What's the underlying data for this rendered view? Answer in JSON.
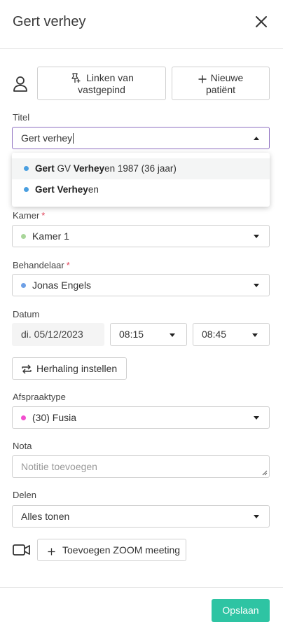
{
  "header": {
    "title": "Gert verhey",
    "close_icon": "close-icon"
  },
  "patient_actions": {
    "person_icon": "person-icon",
    "link_pinned": {
      "icon": "pin-icon",
      "line1": "Linken van",
      "line2": "vastgepind"
    },
    "new_patient": {
      "icon": "plus-icon",
      "line1": "Nieuwe",
      "line2": "patiënt"
    }
  },
  "title_field": {
    "label": "Titel",
    "value": "Gert verhey",
    "options": [
      {
        "bold1": "Gert",
        "text1": " GV ",
        "bold2": "Verhey",
        "text2": "en 1987 (36 jaar)",
        "dot_color": "#4a9fe0"
      },
      {
        "bold1": "Gert",
        "text1": " ",
        "bold2": "Verhey",
        "text2": "en",
        "dot_color": "#4a9fe0"
      }
    ]
  },
  "room": {
    "label": "Kamer",
    "required": "*",
    "value": "Kamer 1",
    "dot_color": "#a9d69a"
  },
  "practitioner": {
    "label": "Behandelaar",
    "required": "*",
    "value": "Jonas Engels",
    "dot_color": "#6ea0e6"
  },
  "date": {
    "label": "Datum",
    "value": "di. 05/12/2023",
    "start": "08:15",
    "end": "08:45"
  },
  "repeat": {
    "icon": "repeat-icon",
    "label": "Herhaling instellen"
  },
  "appointment_type": {
    "label": "Afspraaktype",
    "value": "(30) Fusia",
    "dot_color": "#f24fcf"
  },
  "note": {
    "label": "Nota",
    "placeholder": "Notitie toevoegen"
  },
  "share": {
    "label": "Delen",
    "value": "Alles tonen"
  },
  "zoom": {
    "icon": "video-icon",
    "label": "Toevoegen ZOOM meeting"
  },
  "footer": {
    "save_label": "Opslaan"
  },
  "colors": {
    "accent": "#2ec4a3",
    "active_border": "#8e6fc1",
    "required": "#e0445a"
  }
}
